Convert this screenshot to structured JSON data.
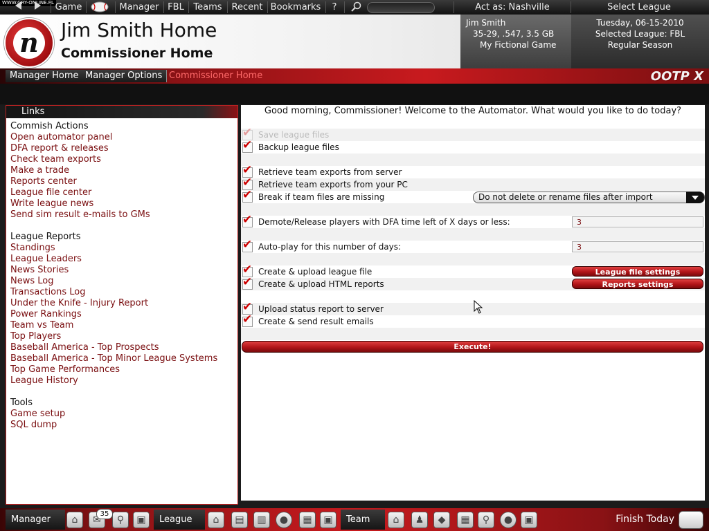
{
  "watermark": "WWW.GRY-ONLINE.PL",
  "menu": {
    "game": "Game",
    "manager": "Manager",
    "fbl": "FBL",
    "teams": "Teams",
    "recent": "Recent",
    "bookmarks": "Bookmarks",
    "help": "?",
    "act_as": "Act as: Nashville",
    "select_league": "Select League"
  },
  "header": {
    "title": "Jim Smith Home",
    "subtitle": "Commissioner Home",
    "logo_letter": "n",
    "user": {
      "name": "Jim Smith",
      "record": "35-29, .547, 3.5 GB",
      "game": "My Fictional Game"
    },
    "league": {
      "date": "Tuesday, 06-15-2010",
      "selected": "Selected League: FBL",
      "season": "Regular Season"
    }
  },
  "tabs": [
    "Manager Home",
    "Manager Options",
    "Commissioner Home"
  ],
  "brand": "OOTP X",
  "links": {
    "heading": "Links",
    "sections": [
      {
        "header": "Commish Actions",
        "items": [
          "Open automator panel",
          "DFA report & releases",
          "Check team exports",
          "Make a trade",
          "Reports center",
          "League file center",
          "Write league news",
          "Send sim result e-mails to GMs"
        ]
      },
      {
        "header": "League Reports",
        "items": [
          "Standings",
          "League Leaders",
          "News Stories",
          "News Log",
          "Transactions Log",
          "Under the Knife - Injury Report",
          "Power Rankings",
          "Team vs Team",
          "Top Players",
          "Baseball America - Top Prospects",
          "Baseball America - Top Minor League Systems",
          "Top Game Performances",
          "League History"
        ]
      },
      {
        "header": "Tools",
        "items": [
          "Game setup",
          "SQL dump"
        ]
      }
    ]
  },
  "automator": {
    "greeting": "Good morning, Commissioner! Welcome to the Automator. What would you like to do today?",
    "options": [
      {
        "label": "Save league files",
        "checked": true,
        "disabled": true
      },
      {
        "label": "Backup league files",
        "checked": true
      },
      {
        "label": "Retrieve team exports from server",
        "checked": true
      },
      {
        "label": "Retrieve team exports from your PC",
        "checked": true
      },
      {
        "label": "Break if team files are missing",
        "checked": true
      },
      {
        "label": "Demote/Release players with DFA time left of X days or less:",
        "checked": true
      },
      {
        "label": "Auto-play for this number of days:",
        "checked": true
      },
      {
        "label": "Create & upload league file",
        "checked": true
      },
      {
        "label": "Create & upload HTML reports",
        "checked": true
      },
      {
        "label": "Upload status report to server",
        "checked": true
      },
      {
        "label": "Create & send result emails",
        "checked": true
      }
    ],
    "import_option": "Do not delete or rename files after import",
    "dfa_days": "3",
    "autoplay_days": "3",
    "league_file_settings": "League file settings",
    "reports_settings": "Reports settings",
    "execute": "Execute!"
  },
  "bottom": {
    "manager": "Manager",
    "league": "League",
    "team": "Team",
    "mail_count": "35",
    "finish": "Finish Today"
  }
}
